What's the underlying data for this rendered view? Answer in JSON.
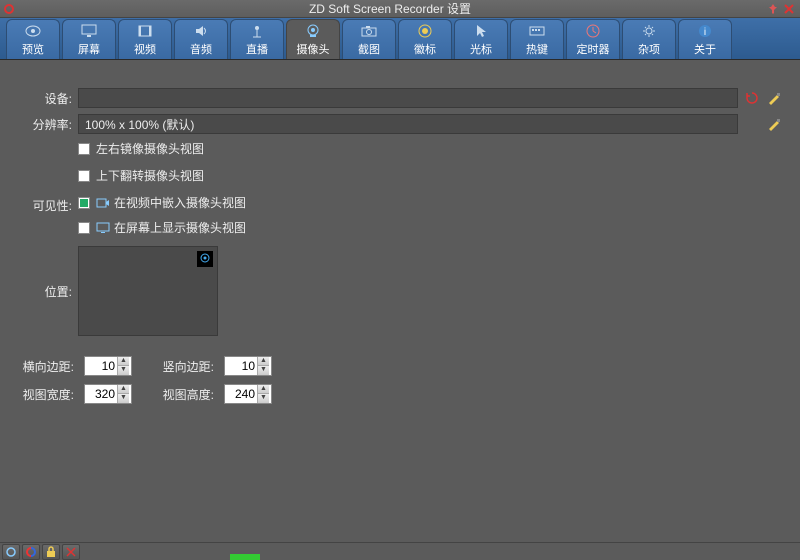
{
  "window": {
    "title": "ZD Soft Screen Recorder 设置"
  },
  "tabs": [
    {
      "label": "预览",
      "icon": "eye"
    },
    {
      "label": "屏幕",
      "icon": "monitor"
    },
    {
      "label": "视频",
      "icon": "film"
    },
    {
      "label": "音频",
      "icon": "speaker"
    },
    {
      "label": "直播",
      "icon": "antenna"
    },
    {
      "label": "摄像头",
      "icon": "webcam",
      "active": true
    },
    {
      "label": "截图",
      "icon": "camera"
    },
    {
      "label": "徽标",
      "icon": "badge"
    },
    {
      "label": "光标",
      "icon": "cursor"
    },
    {
      "label": "热键",
      "icon": "keyboard"
    },
    {
      "label": "定时器",
      "icon": "clock"
    },
    {
      "label": "杂项",
      "icon": "gear"
    },
    {
      "label": "关于",
      "icon": "info"
    }
  ],
  "labels": {
    "device": "设备:",
    "resolution": "分辨率:",
    "visibility": "可见性:",
    "position": "位置:",
    "hmargin": "横向边距:",
    "vmargin": "竖向边距:",
    "vwidth": "视图宽度:",
    "vheight": "视图高度:"
  },
  "fields": {
    "device": "",
    "resolution": "100% x 100% (默认)"
  },
  "checkboxes": {
    "mirror": {
      "label": "左右镜像摄像头视图",
      "checked": false
    },
    "flip": {
      "label": "上下翻转摄像头视图",
      "checked": false
    },
    "embed": {
      "label": "在视频中嵌入摄像头视图",
      "checked": true
    },
    "overlay": {
      "label": "在屏幕上显示摄像头视图",
      "checked": false
    }
  },
  "numbers": {
    "hmargin": 10,
    "vmargin": 10,
    "vwidth": 320,
    "vheight": 240
  },
  "colors": {
    "tabbar": "#3a6aa3",
    "bg": "#5b5b5b"
  }
}
